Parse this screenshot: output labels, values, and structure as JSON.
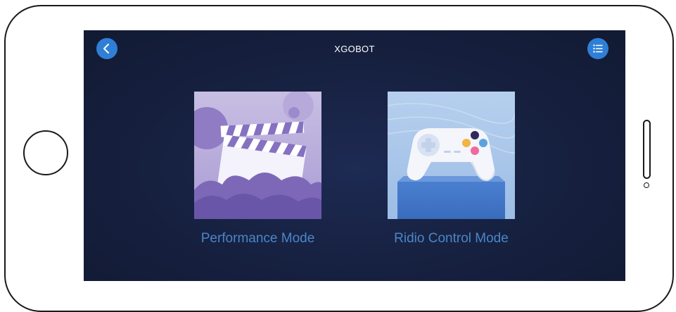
{
  "app": {
    "title": "XGOBOT"
  },
  "header": {
    "back_icon": "chevron-left-icon",
    "menu_icon": "list-menu-icon",
    "accent_color": "#2f7fd6"
  },
  "modes": [
    {
      "label": "Performance Mode",
      "icon": "clapperboard-icon"
    },
    {
      "label": "Ridio Control Mode",
      "icon": "gamepad-icon"
    }
  ],
  "colors": {
    "screen_background": "#16203f",
    "label_color": "#4a86c8"
  }
}
